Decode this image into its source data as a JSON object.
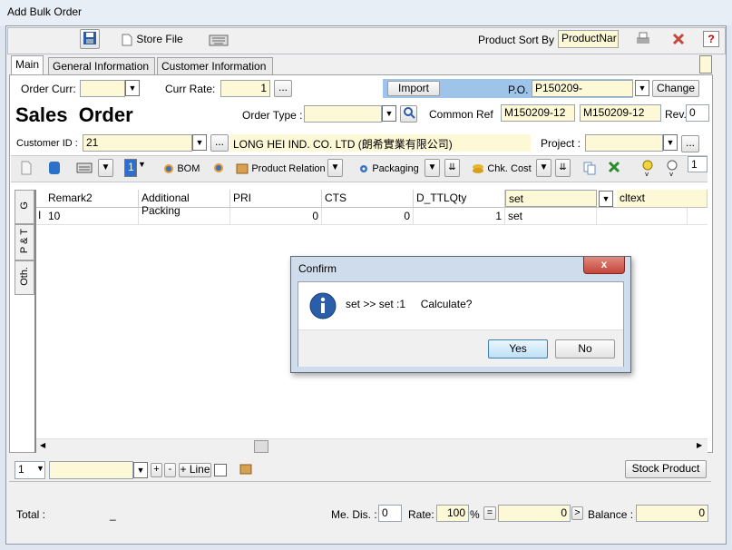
{
  "window": {
    "title": "Add Bulk Order"
  },
  "toolbar": {
    "store_file": "Store File",
    "product_sort_by_label": "Product Sort By",
    "product_sort_by_value": "ProductNar"
  },
  "tabs": [
    "Main",
    "General Information",
    "Customer Information"
  ],
  "header": {
    "order_curr_label": "Order Curr:",
    "order_curr_value": "",
    "curr_rate_label": "Curr Rate:",
    "curr_rate_value": "1",
    "ellipsis": "...",
    "import_label": "Import",
    "po_label": "P.O.",
    "po_value": "P150209-",
    "change_label": "Change",
    "page_title": "Sales  Order",
    "order_type_label": "Order Type :",
    "order_type_value": "",
    "common_ref_label": "Common Ref",
    "common_ref_value1": "M150209-12",
    "common_ref_value2": "M150209-12",
    "rev_label": "Rev.",
    "rev_value": "0",
    "customer_id_label": "Customer ID :",
    "customer_id_value": "21",
    "customer_name": "LONG HEI IND. CO. LTD (朗希實業有限公司)",
    "project_label": "Project :",
    "project_value": ""
  },
  "toolbar2": {
    "qty_value": "1",
    "bom_label": "BOM",
    "product_relation_label": "Product Relation",
    "packaging_label": "Packaging",
    "chk_cost_label": "Chk. Cost",
    "right_value": "1"
  },
  "side_tabs": [
    "G",
    "P & T",
    "Oth."
  ],
  "grid": {
    "columns": [
      "Remark2",
      "Additional Packing",
      "PRI",
      "CTS",
      "D_TTLQty",
      "set",
      "cltext"
    ],
    "rows": [
      {
        "remark2": "10",
        "additional_packing": "",
        "pri": "0",
        "cts": "0",
        "d_ttlqty": "1",
        "set": "set",
        "cltext": ""
      }
    ]
  },
  "footer": {
    "page_value": "1",
    "plus": "+",
    "minus": "-",
    "add_line": "+ Line",
    "stock_product": "Stock Product",
    "total_label": "Total :",
    "total_value": "_",
    "me_dis_label": "Me. Dis. :",
    "me_dis_value": "0",
    "rate_label": "Rate:",
    "rate_value": "100",
    "percent": "%",
    "equals": "=",
    "amount_value": "0",
    "arrow": ">",
    "balance_label": "Balance :",
    "balance_value": "0"
  },
  "dialog": {
    "title": "Confirm",
    "message": "set >> set :1     Calculate?",
    "yes": "Yes",
    "no": "No",
    "close": "x"
  },
  "colors": {
    "field_yellow": "#fdf8d6",
    "highlight_blue": "#9fc4ea",
    "close_red": "#c7453a"
  },
  "icons": [
    "save-icon",
    "document-icon",
    "keyboard-icon",
    "printer-icon",
    "close-icon",
    "help-icon",
    "info-icon"
  ]
}
